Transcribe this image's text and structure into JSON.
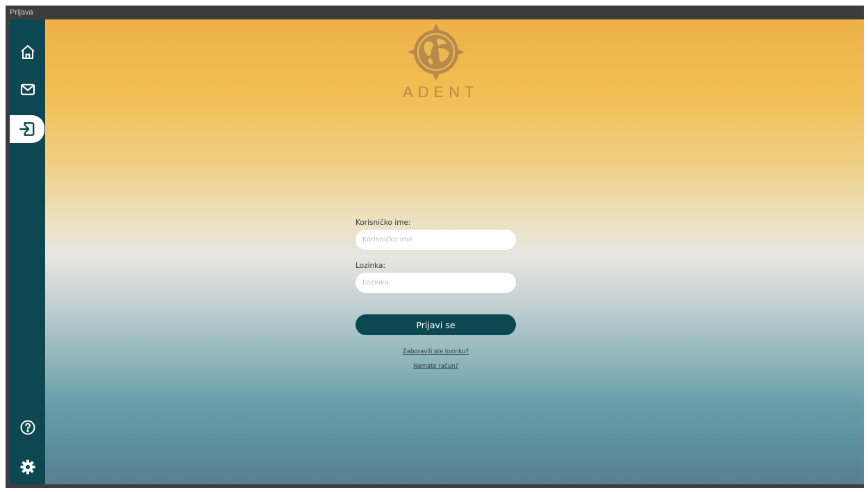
{
  "window": {
    "title": "Prijava"
  },
  "sidebar": {
    "items": [
      {
        "icon": "home-icon"
      },
      {
        "icon": "mail-icon"
      },
      {
        "icon": "login-icon",
        "active": true
      },
      {
        "icon": "help-icon"
      },
      {
        "icon": "gear-icon"
      }
    ]
  },
  "logo": {
    "text": "ADENT"
  },
  "form": {
    "username_label": "Korisničko ime:",
    "username_placeholder": "Korisničko ime",
    "username_value": "",
    "password_label": "Lozinka:",
    "password_placeholder": "Lozinka",
    "password_value": "",
    "submit_label": "Prijavi se",
    "forgot_link": "Zaboravili ste lozinku?",
    "register_link": "Nemate račun?"
  },
  "colors": {
    "sidebar": "#0d4852",
    "accent": "#0d4852",
    "logo": "#b8894a",
    "gradient_top": "#efb04a",
    "gradient_bottom": "#5a7f91"
  }
}
